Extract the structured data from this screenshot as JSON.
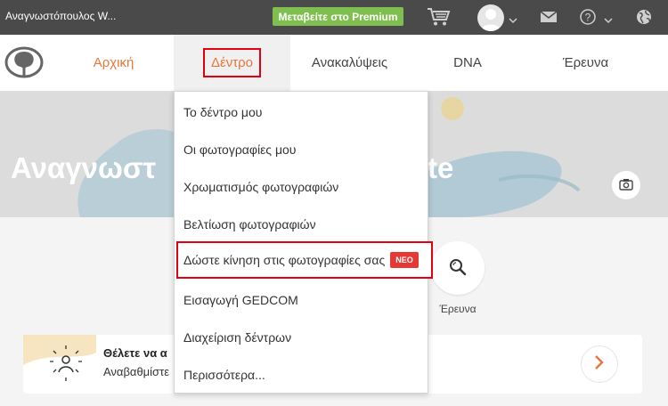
{
  "topbar": {
    "tree_name": "Αναγνωστόπουλος W...",
    "premium_label": "Μεταβείτε στο Premium"
  },
  "nav": {
    "home": "Αρχική",
    "tree": "Δέντρο",
    "discoveries": "Ανακαλύψεις",
    "dna": "DNA",
    "research": "Έρευνα"
  },
  "hero": {
    "title_start": "Αναγνωστ",
    "title_end": "te"
  },
  "dropdown": {
    "items": [
      {
        "label": "Το δέντρο μου"
      },
      {
        "label": "Οι φωτογραφίες μου"
      },
      {
        "label": "Χρωματισμός φωτογραφιών"
      },
      {
        "label": "Βελτίωση φωτογραφιών"
      },
      {
        "label": "Δώστε κίνηση στις φωτογραφίες σας",
        "badge": "ΝΕΟ"
      },
      {
        "label": "Εισαγωγή GEDCOM"
      },
      {
        "label": "Διαχείριση δέντρων"
      },
      {
        "label": "Περισσότερα..."
      }
    ]
  },
  "research_shortcut": {
    "label": "Έρευνα"
  },
  "upgrade_card": {
    "title": "Θέλετε να α",
    "subtitle": "Αναβαθμίστε"
  },
  "colors": {
    "accent": "#e8763a",
    "premium": "#7fbf4f",
    "topbar": "#4a4a4a",
    "highlight_border": "#e3000f",
    "badge": "#e53935"
  },
  "icons": [
    "cart-icon",
    "avatar-icon",
    "mail-icon",
    "help-icon",
    "globe-icon",
    "camera-icon",
    "search-icon",
    "chevron-right-icon",
    "sun-person-icon"
  ]
}
